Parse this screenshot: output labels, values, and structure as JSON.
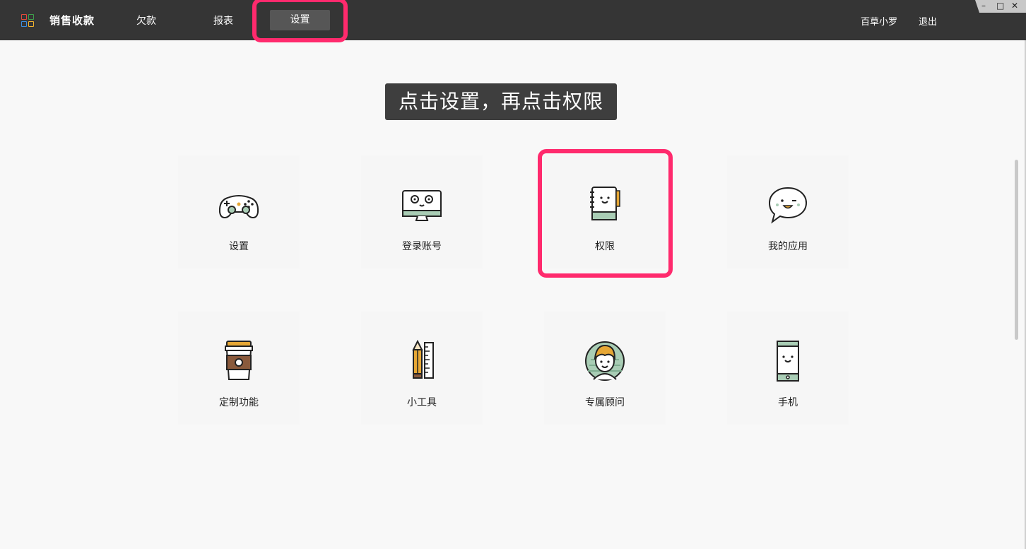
{
  "header": {
    "app_title": "销售收款",
    "nav": [
      {
        "label": "欠款"
      },
      {
        "label": "报表"
      },
      {
        "label": "设置",
        "active": true
      }
    ],
    "user_name": "百草小罗",
    "logout_label": "退出",
    "window_controls": {
      "minimize": "–",
      "maximize": "□",
      "close": "✕"
    }
  },
  "banner": {
    "text": "点击设置，再点击权限"
  },
  "cards": [
    {
      "label": "设置",
      "icon": "gamepad-icon"
    },
    {
      "label": "登录账号",
      "icon": "monitor-icon"
    },
    {
      "label": "权限",
      "icon": "notebook-icon",
      "highlighted": true
    },
    {
      "label": "我的应用",
      "icon": "chat-bubble-icon"
    },
    {
      "label": "定制功能",
      "icon": "coffee-cup-icon"
    },
    {
      "label": "小工具",
      "icon": "pencil-ruler-icon"
    },
    {
      "label": "专属顾问",
      "icon": "advisor-avatar-icon"
    },
    {
      "label": "手机",
      "icon": "phone-icon"
    }
  ],
  "colors": {
    "topbar": "#353535",
    "highlight": "#ff2a6d",
    "accent_green": "#a9cdb5",
    "accent_brown": "#8a5a3c",
    "accent_gold": "#e6a735"
  }
}
